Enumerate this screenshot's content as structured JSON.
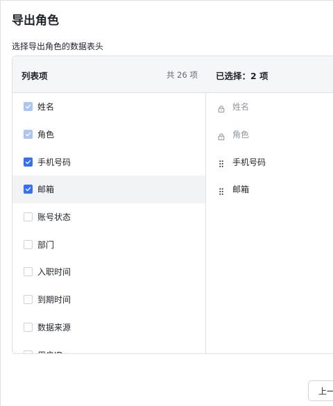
{
  "dialog": {
    "title": "导出角色",
    "subtitle": "选择导出角色的数据表头"
  },
  "left_panel": {
    "title": "列表项",
    "count_label": "共 26 项",
    "items": [
      {
        "label": "姓名",
        "state": "disabled-checked"
      },
      {
        "label": "角色",
        "state": "disabled-checked"
      },
      {
        "label": "手机号码",
        "state": "checked"
      },
      {
        "label": "邮箱",
        "state": "checked",
        "hovered": true
      },
      {
        "label": "账号状态",
        "state": "unchecked"
      },
      {
        "label": "部门",
        "state": "unchecked"
      },
      {
        "label": "入职时间",
        "state": "unchecked"
      },
      {
        "label": "到期时间",
        "state": "unchecked"
      },
      {
        "label": "数据来源",
        "state": "unchecked"
      },
      {
        "label": "用户ID",
        "state": "unchecked"
      }
    ]
  },
  "right_panel": {
    "title": "已选择：2 项",
    "items": [
      {
        "label": "姓名",
        "icon": "lock-icon",
        "locked": true
      },
      {
        "label": "角色",
        "icon": "lock-icon",
        "locked": true
      },
      {
        "label": "手机号码",
        "icon": "drag-handle-icon",
        "locked": false
      },
      {
        "label": "邮箱",
        "icon": "drag-handle-icon",
        "locked": false
      }
    ]
  },
  "footer": {
    "prev_label": "上一步"
  },
  "colors": {
    "accent": "#3370ff",
    "disabled_check": "#a9c5f5",
    "header_bg": "#f5f6f7",
    "border": "#dee0e3"
  }
}
